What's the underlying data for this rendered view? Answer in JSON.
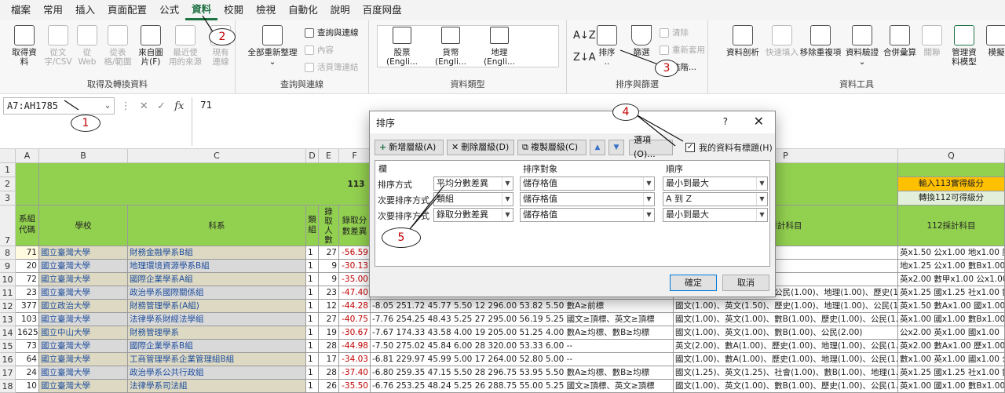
{
  "menu": [
    "檔案",
    "常用",
    "插入",
    "頁面配置",
    "公式",
    "資料",
    "校閱",
    "檢視",
    "自動化",
    "說明",
    "百度网盘"
  ],
  "ribbon": {
    "get_transform": {
      "label": "取得及轉換資料",
      "buttons": [
        "取得資\n料",
        "從文\n字/CSV",
        "從\nWeb",
        "從表\n格/範圍",
        "來自圖\n片(F)",
        "最近使\n用的來源",
        "現有\n連線"
      ]
    },
    "queries": {
      "label": "查詢與連線",
      "refresh": "全部重新整理",
      "items": [
        "查詢與連線",
        "內容",
        "活頁簿連結"
      ]
    },
    "data_types": {
      "label": "資料類型",
      "items": [
        "股票 (Engli...",
        "貨幣 (Engli...",
        "地理 (Engli..."
      ]
    },
    "sort_filter": {
      "label": "排序與篩選",
      "sort": "排序",
      "filter": "篩選",
      "items": [
        "清除",
        "重新套用",
        "進階..."
      ]
    },
    "data_tools": {
      "label": "資料工具",
      "buttons": [
        "資料剖析",
        "快速填入",
        "移除重複項",
        "資料驗證",
        "合併彙算",
        "關聯",
        "管理資\n料模型",
        "模擬"
      ]
    }
  },
  "formula_bar": {
    "name_box": "A7:AH1785",
    "value": "71"
  },
  "columns": [
    "A",
    "B",
    "C",
    "D",
    "E",
    "F",
    "P",
    "Q"
  ],
  "rows": [
    "1",
    "2",
    "3",
    "7",
    "8",
    "9",
    "10",
    "11",
    "12",
    "13",
    "14",
    "15",
    "16",
    "17",
    "18"
  ],
  "headers": {
    "year": "113",
    "col_a": "系組\n代碼",
    "col_b": "學校",
    "col_c": "科系",
    "col_d": "類\n組",
    "col_e": "錄\n取\n人\n數",
    "col_f": "錄取分\n數差異",
    "col_p": "採計科目",
    "q1": "輸入113實得級分",
    "q2": "轉換112可得級分",
    "q3": "112採計科目"
  },
  "table": [
    {
      "code": "71",
      "school": "國立臺灣大學",
      "dept": "財務金融學系B組",
      "grp": "1",
      "n": "27",
      "diff": "-56.59",
      "mid": "",
      "subj": "國文(1.00)、公民(1.00)",
      "q": "英x1.50 公x1.00 地x1.00 歷x1.0"
    },
    {
      "code": "20",
      "school": "國立臺灣大學",
      "dept": "地理環境資源學系B組",
      "grp": "1",
      "n": "9",
      "diff": "-30.13",
      "mid": "",
      "subj": "民(1.00)",
      "q": "地x1.25 公x1.00 數Bx1.00"
    },
    {
      "code": "72",
      "school": "國立臺灣大學",
      "dept": "國際企業學系A組",
      "grp": "1",
      "n": "9",
      "diff": "-35.00",
      "mid": "",
      "subj": "民(1.00)",
      "q": "英x2.00 數甲x1.00 公x1.00"
    },
    {
      "code": "23",
      "school": "國立臺灣大學",
      "dept": "政治學系國際關係組",
      "grp": "1",
      "n": "23",
      "diff": "-47.40",
      "mid": "-8.62  257.08  45.75  5.00  20  ...  數A≥均標、數B≥均標",
      "subj": "國文(1.25)、英文(1.25)、公民(1.00)、地理(1.00)、歷史(1.00)",
      "q": "英x1.25 國x1.25 社x1.00 數x1.0"
    },
    {
      "code": "377",
      "school": "國立政治大學",
      "dept": "財務管理學系(A組)",
      "grp": "1",
      "n": "12",
      "diff": "-44.28",
      "mid": "-8.05  251.72  45.77  5.50  12  296.00  53.82  5.50  數A≥前標",
      "subj": "國文(1.00)、英文(1.50)、歷史(1.00)、地理(1.00)、公民(1.00)",
      "q": "英x1.50 數Ax1.00 國x1.00 公x1.0"
    },
    {
      "code": "103",
      "school": "國立臺灣大學",
      "dept": "法律學系財經法學組",
      "grp": "1",
      "n": "27",
      "diff": "-40.75",
      "mid": "-7.76  254.25  48.43  5.25  27  295.00  56.19  5.25  國文≥頂標、英文≥頂標",
      "subj": "國文(1.00)、英文(1.00)、數B(1.00)、歷史(1.00)、公民(1.25)",
      "q": "英x1.00 國x1.00 數Bx1.00 公x1.0"
    },
    {
      "code": "1625",
      "school": "國立中山大學",
      "dept": "財務管理學系",
      "grp": "1",
      "n": "19",
      "diff": "-30.67",
      "mid": "-7.67  174.33  43.58  4.00  19  205.00  51.25  4.00  數A≥均標、數B≥均標",
      "subj": "國文(1.00)、英文(1.00)、數B(1.00)、公民(2.00)",
      "q": "公x2.00 英x1.00 國x1.00"
    },
    {
      "code": "73",
      "school": "國立臺灣大學",
      "dept": "國際企業學系B組",
      "grp": "1",
      "n": "28",
      "diff": "-44.98",
      "mid": "-7.50  275.02  45.84  6.00  28  320.00  53.33  6.00  --",
      "subj": "英文(2.00)、數A(1.00)、歷史(1.00)、地理(1.00)、公民(1.00)",
      "q": "英x2.00 數Ax1.00 歷x1.00 地x1.0"
    },
    {
      "code": "64",
      "school": "國立臺灣大學",
      "dept": "工商管理學系企業管理組B組",
      "grp": "1",
      "n": "17",
      "diff": "-34.03",
      "mid": "-6.81  229.97  45.99  5.00  17  264.00  52.80  5.00  --",
      "subj": "國文(1.00)、數A(1.00)、歷史(1.00)、地理(1.00)、公民(1.00)",
      "q": "數x1.00 英x1.00 國x1.00 公x1.0"
    },
    {
      "code": "24",
      "school": "國立臺灣大學",
      "dept": "政治學系公共行政組",
      "grp": "1",
      "n": "28",
      "diff": "-37.40",
      "mid": "-6.80  259.35  47.15  5.50  28  296.75  53.95  5.50  數A≥均標、數B≥均標",
      "subj": "國文(1.25)、英文(1.25)、社會(1.00)、數B(1.00)、地理(1.00)",
      "q": "英x1.25 國x1.25 社x1.00 數x1.0"
    },
    {
      "code": "10",
      "school": "國立臺灣大學",
      "dept": "法律學系司法組",
      "grp": "1",
      "n": "26",
      "diff": "-35.50",
      "mid": "-6.76  253.25  48.24  5.25  26  288.75  55.00  5.25  國文≥頂標、英文≥頂標",
      "subj": "國文(1.00)、英文(1.00)、數B(1.00)、歷史(1.00)、公民(1.25)",
      "q": "英x1.00 國x1.00 數Bx1.00 公x1.0"
    }
  ],
  "dialog": {
    "title": "排序",
    "help": "?",
    "close": "✕",
    "add_level": "新增層級(A)",
    "delete_level": "刪除層級(D)",
    "copy_level": "複製層級(C)",
    "up": "▲",
    "down": "▼",
    "options": "選項(O)...",
    "has_headers": "我的資料有標題(H)",
    "col_head": "欄",
    "sort_on_head": "排序對象",
    "order_head": "順序",
    "levels": [
      {
        "label": "排序方式",
        "column": "平均分數差異",
        "sort_on": "儲存格值",
        "order": "最小到最大"
      },
      {
        "label": "次要排序方式",
        "column": "類組",
        "sort_on": "儲存格值",
        "order": "A 到 Z"
      },
      {
        "label": "次要排序方式",
        "column": "錄取分數差異",
        "sort_on": "儲存格值",
        "order": "最小到最大"
      }
    ],
    "ok": "確定",
    "cancel": "取消"
  },
  "callouts": [
    "1",
    "2",
    "3",
    "4",
    "5"
  ],
  "colors": {
    "accent": "#217346",
    "header_green": "#92d050",
    "orange": "#ffc000",
    "callout_red": "#c00000"
  }
}
